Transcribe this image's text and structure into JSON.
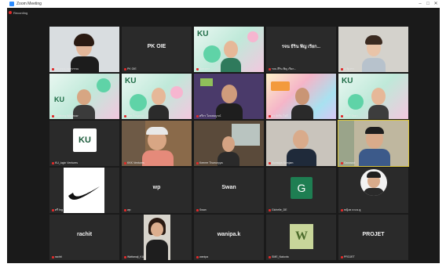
{
  "window": {
    "title": "Zoom Meeting",
    "controls": [
      "–",
      "□",
      "✕"
    ]
  },
  "recording": {
    "label": "Recording"
  },
  "tiles": [
    {
      "name": "ทิพวรรณ ลดสุวรรณ",
      "center_text": ""
    },
    {
      "name": "PK OIE",
      "center_text": "PK OIE"
    },
    {
      "name": "ฉัตรจุฑา",
      "center_text": ""
    },
    {
      "name": "รจน ธีริน ฟิญ เรียก...",
      "center_text": "รจน ธีริน ฟิญ เรียก..."
    },
    {
      "name": "ภ.รัฐวรา",
      "center_text": ""
    },
    {
      "name": "Chattong Wisanuw",
      "center_text": ""
    },
    {
      "name": "ฉัตร ใหญ่ราม",
      "center_text": ""
    },
    {
      "name": "ศรีกร โภคสมบูรณ์",
      "center_text": ""
    },
    {
      "name": "ดร.จักริน ใจดี",
      "center_text": ""
    },
    {
      "name": "ศรีนรี ปัตยา",
      "center_text": ""
    },
    {
      "name": "KU_login Ventures",
      "center_text": ""
    },
    {
      "name": "KKK Ventures",
      "center_text": ""
    },
    {
      "name": "Keeree Thoeunyya",
      "center_text": ""
    },
    {
      "name": "Surasiya Somjam",
      "center_text": ""
    },
    {
      "name": "Sawawut",
      "center_text": ""
    },
    {
      "name": "ศรี Ing",
      "center_text": ""
    },
    {
      "name": "wp",
      "center_text": "wp"
    },
    {
      "name": "Swan",
      "center_text": "Swan"
    },
    {
      "name": "Gichelle_DE",
      "center_text": "G"
    },
    {
      "name": "หญิงต ดวงจ.ฮู",
      "center_text": ""
    },
    {
      "name": "rachit",
      "center_text": "rachit"
    },
    {
      "name": "Wattanaji_KU",
      "center_text": ""
    },
    {
      "name": "wanipa",
      "center_text": "wanipa.k"
    },
    {
      "name": "SME_Nakorla",
      "center_text": ""
    },
    {
      "name": "PROJET",
      "center_text": "PROJET"
    }
  ],
  "logos": {
    "ku": "KU",
    "w": "W"
  },
  "colors": {
    "meeting_bg": "#1a1a1a",
    "tile_bg": "#2a2a2a",
    "muted_mic": "#e02a2a",
    "zoom_blue": "#2d8cff"
  }
}
